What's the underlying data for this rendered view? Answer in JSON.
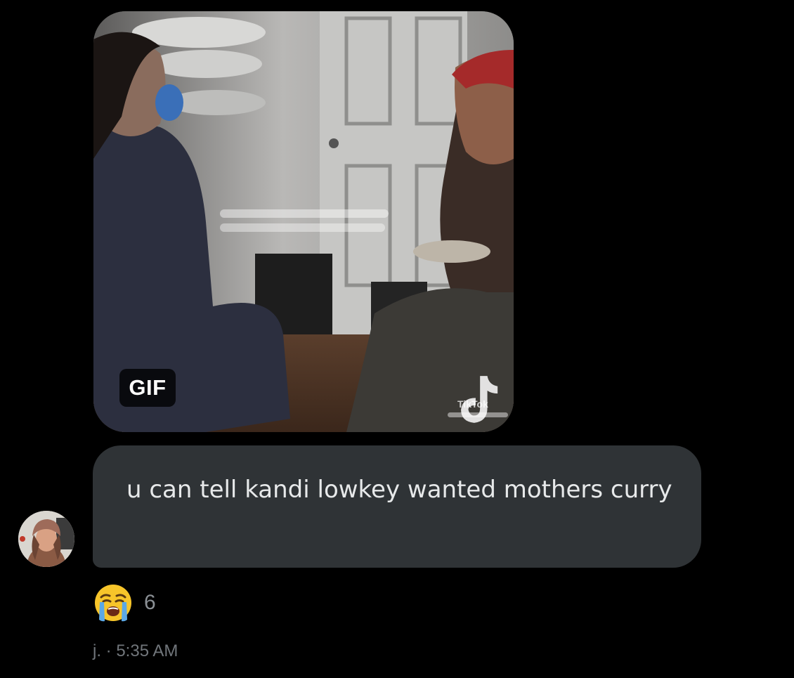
{
  "media": {
    "badge": "GIF",
    "watermark_brand": "TikTok",
    "icon": "tiktok-icon"
  },
  "message": {
    "text": "u can tell kandi lowkey wanted mothers curry",
    "bubble_color": "#2f3336",
    "text_color": "#e7e9ea"
  },
  "reaction": {
    "emoji_icon": "loudly-crying-face-icon",
    "count": "6"
  },
  "meta": {
    "sender": "j.",
    "separator": "·",
    "time": "5:35 AM",
    "line": "j. · 5:35 AM"
  },
  "colors": {
    "background": "#000000",
    "muted_text": "#71767b"
  }
}
